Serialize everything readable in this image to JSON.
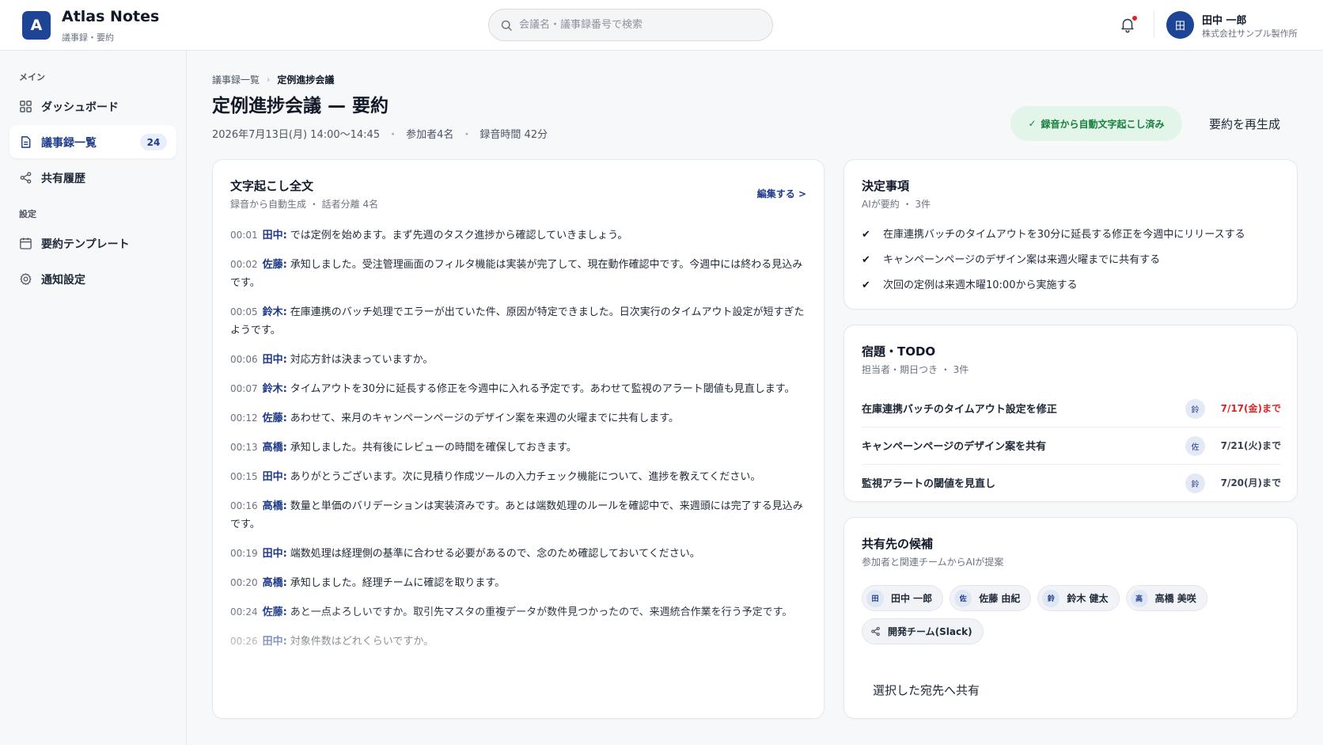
{
  "header": {
    "logo_letter": "A",
    "app_title": "Atlas Notes",
    "app_subtitle": "議事録・要約",
    "search_placeholder": "会議名・議事録番号で検索",
    "user": {
      "avatar": "田",
      "name": "田中 一郎",
      "company": "株式会社サンプル製作所"
    },
    "icons": {
      "search": "search-icon",
      "notifications": "bell-icon"
    }
  },
  "sidebar": {
    "sections": [
      {
        "label": "メイン"
      },
      {
        "label": "設定"
      }
    ],
    "items": [
      {
        "label": "ダッシュボード",
        "icon": "grid-icon"
      },
      {
        "label": "議事録一覧",
        "icon": "document-icon",
        "badge": "24",
        "active": true
      },
      {
        "label": "共有履歴",
        "icon": "share-icon"
      },
      {
        "label": "要約テンプレート",
        "icon": "calendar-icon"
      },
      {
        "label": "通知設定",
        "icon": "gear-icon"
      }
    ]
  },
  "page": {
    "breadcrumb": [
      "議事録一覧",
      "定例進捗会議"
    ],
    "title": "定例進捗会議",
    "title_suffix": "— 要約",
    "meta": {
      "datetime": "2026年7月13日(月) 14:00〜14:45",
      "participants": "参加者4名",
      "duration": "録音時間 42分"
    },
    "status": "録音から自動文字起こし済み",
    "regenerate_label": "要約を再生成"
  },
  "transcript": {
    "title": "文字起こし全文",
    "subtitle": "録音から自動生成 ・ 話者分離 4名",
    "edit_label": "編集する >",
    "lines": [
      {
        "time": "00:01",
        "speaker": "田中:",
        "text": "では定例を始めます。まず先週のタスク進捗から確認していきましょう。"
      },
      {
        "time": "00:02",
        "speaker": "佐藤:",
        "text": "承知しました。受注管理画面のフィルタ機能は実装が完了して、現在動作確認中です。今週中には終わる見込みです。"
      },
      {
        "time": "00:05",
        "speaker": "鈴木:",
        "text": "在庫連携のバッチ処理でエラーが出ていた件、原因が特定できました。日次実行のタイムアウト設定が短すぎたようです。"
      },
      {
        "time": "00:06",
        "speaker": "田中:",
        "text": "対応方針は決まっていますか。"
      },
      {
        "time": "00:07",
        "speaker": "鈴木:",
        "text": "タイムアウトを30分に延長する修正を今週中に入れる予定です。あわせて監視のアラート閾値も見直します。"
      },
      {
        "time": "00:12",
        "speaker": "佐藤:",
        "text": "あわせて、来月のキャンペーンページのデザイン案を来週の火曜までに共有します。"
      },
      {
        "time": "00:13",
        "speaker": "高橋:",
        "text": "承知しました。共有後にレビューの時間を確保しておきます。"
      },
      {
        "time": "00:15",
        "speaker": "田中:",
        "text": "ありがとうございます。次に見積り作成ツールの入力チェック機能について、進捗を教えてください。"
      },
      {
        "time": "00:16",
        "speaker": "高橋:",
        "text": "数量と単価のバリデーションは実装済みです。あとは端数処理のルールを確認中で、来週頭には完了する見込みです。"
      },
      {
        "time": "00:19",
        "speaker": "田中:",
        "text": "端数処理は経理側の基準に合わせる必要があるので、念のため確認しておいてください。"
      },
      {
        "time": "00:20",
        "speaker": "高橋:",
        "text": "承知しました。経理チームに確認を取ります。"
      },
      {
        "time": "00:24",
        "speaker": "佐藤:",
        "text": "あと一点よろしいですか。取引先マスタの重複データが数件見つかったので、来週統合作業を行う予定です。"
      },
      {
        "time": "00:26",
        "speaker": "田中:",
        "text": "対象件数はどれくらいですか。"
      }
    ]
  },
  "decisions": {
    "title": "決定事項",
    "subtitle": "AIが要約 ・ 3件",
    "items": [
      "在庫連携バッチのタイムアウトを30分に延長する修正を今週中にリリースする",
      "キャンペーンページのデザイン案は来週火曜までに共有する",
      "次回の定例は来週木曜10:00から実施する"
    ]
  },
  "todos": {
    "title": "宿題・TODO",
    "subtitle": "担当者・期日つき ・ 3件",
    "items": [
      {
        "text": "在庫連携バッチのタイムアウト設定を修正",
        "assignee": "鈴",
        "due": "7/17(金)まで",
        "urgent": true
      },
      {
        "text": "キャンペーンページのデザイン案を共有",
        "assignee": "佐",
        "due": "7/21(火)まで",
        "urgent": false
      },
      {
        "text": "監視アラートの閾値を見直し",
        "assignee": "鈴",
        "due": "7/20(月)まで",
        "urgent": false
      }
    ],
    "colors": {
      "urgent": "#dc2626",
      "normal": "#374151"
    }
  },
  "share": {
    "title": "共有先の候補",
    "subtitle": "参加者と関連チームからAIが提案",
    "chips": [
      {
        "initial": "田",
        "label": "田中 一郎"
      },
      {
        "initial": "佐",
        "label": "佐藤 由紀"
      },
      {
        "initial": "鈴",
        "label": "鈴木 健太"
      },
      {
        "initial": "高",
        "label": "高橋 美咲"
      },
      {
        "icon": "share-icon",
        "label": "開発チーム(Slack)"
      }
    ],
    "button_label": "選択した宛先へ共有"
  },
  "colors": {
    "brand": "#1e4595",
    "success_bg": "#e3f5e9",
    "success_text": "#15803d",
    "danger": "#dc2626"
  }
}
